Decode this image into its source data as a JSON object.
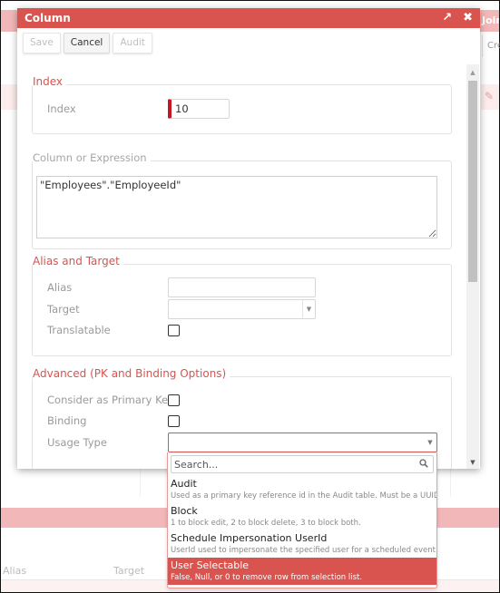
{
  "background": {
    "join_tab_label": "Join",
    "create_button_label": "Cre",
    "table_headers": [
      "Alias",
      "Target"
    ]
  },
  "dialog": {
    "title": "Column",
    "controls": {
      "maximize_icon": "arrow-up-right-icon",
      "close_icon": "close-icon"
    },
    "toolbar": {
      "save_label": "Save",
      "cancel_label": "Cancel",
      "audit_label": "Audit"
    },
    "sections": {
      "index": {
        "legend": "Index",
        "index_label": "Index",
        "index_value": "10"
      },
      "expression": {
        "legend": "Column or Expression",
        "value": "\"Employees\".\"EmployeeId\""
      },
      "alias_target": {
        "legend": "Alias and Target",
        "alias_label": "Alias",
        "alias_value": "",
        "target_label": "Target",
        "target_value": "",
        "translatable_label": "Translatable",
        "translatable_checked": false
      },
      "advanced": {
        "legend": "Advanced (PK and Binding Options)",
        "primary_key_label": "Consider as Primary Key",
        "primary_key_checked": false,
        "binding_label": "Binding",
        "binding_checked": false,
        "usage_type_label": "Usage Type",
        "usage_type_value": ""
      }
    }
  },
  "usage_dropdown": {
    "search_placeholder": "Search...",
    "search_value": "",
    "options": [
      {
        "title": "Audit",
        "description": "Used as a primary key reference id in the Audit table. Must be a UUID.",
        "highlighted": false
      },
      {
        "title": "Block",
        "description": "1 to block edit, 2 to block delete, 3 to block both.",
        "highlighted": false
      },
      {
        "title": "Schedule Impersonation UserId",
        "description": "UserId used to impersonate the specified user for a scheduled event.",
        "highlighted": false
      },
      {
        "title": "User Selectable",
        "description": "False, Null, or 0 to remove row from selection list.",
        "highlighted": true
      }
    ]
  },
  "colors": {
    "accent": "#d9534f",
    "required_marker": "#c9151e",
    "background_band": "#f2b8b9"
  }
}
